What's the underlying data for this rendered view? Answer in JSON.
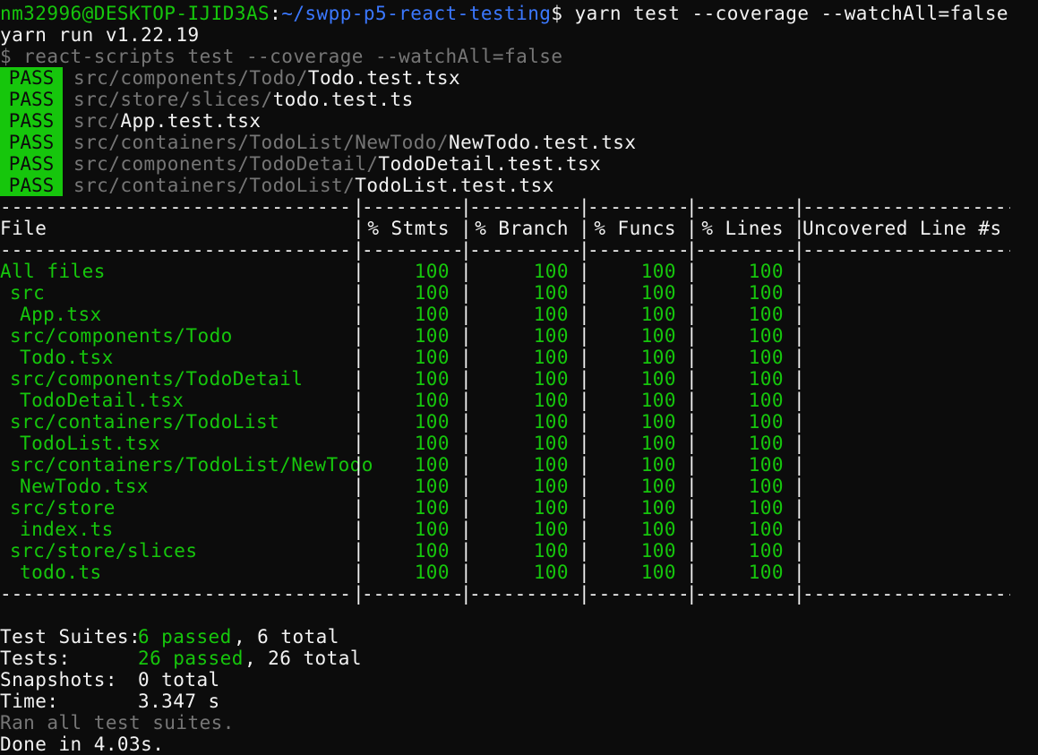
{
  "prompt": {
    "user_host": "nm32996@DESKTOP-IJID3AS",
    "path": "~/swpp-p5-react-testing",
    "symbol": "$",
    "command": "yarn test --coverage --watchAll=false"
  },
  "yarn_line": "yarn run v1.22.19",
  "script_line": "$ react-scripts test --coverage --watchAll=false",
  "test_results": [
    {
      "status": "PASS",
      "dir": "src/components/Todo/",
      "file": "Todo.test.tsx"
    },
    {
      "status": "PASS",
      "dir": "src/store/slices/",
      "file": "todo.test.ts"
    },
    {
      "status": "PASS",
      "dir": "src/",
      "file": "App.test.tsx"
    },
    {
      "status": "PASS",
      "dir": "src/containers/TodoList/NewTodo/",
      "file": "NewTodo.test.tsx"
    },
    {
      "status": "PASS",
      "dir": "src/components/TodoDetail/",
      "file": "TodoDetail.test.tsx"
    },
    {
      "status": "PASS",
      "dir": "src/containers/TodoList/",
      "file": "TodoList.test.tsx"
    }
  ],
  "coverage_table": {
    "headers": [
      "File",
      "% Stmts",
      "% Branch",
      "% Funcs",
      "% Lines",
      "Uncovered Line #s"
    ],
    "rows": [
      {
        "file": "All files",
        "indent": 0,
        "stmts": "100",
        "branch": "100",
        "funcs": "100",
        "lines": "100",
        "uncovered": ""
      },
      {
        "file": "src",
        "indent": 1,
        "stmts": "100",
        "branch": "100",
        "funcs": "100",
        "lines": "100",
        "uncovered": ""
      },
      {
        "file": "App.tsx",
        "indent": 2,
        "stmts": "100",
        "branch": "100",
        "funcs": "100",
        "lines": "100",
        "uncovered": ""
      },
      {
        "file": "src/components/Todo",
        "indent": 1,
        "stmts": "100",
        "branch": "100",
        "funcs": "100",
        "lines": "100",
        "uncovered": ""
      },
      {
        "file": "Todo.tsx",
        "indent": 2,
        "stmts": "100",
        "branch": "100",
        "funcs": "100",
        "lines": "100",
        "uncovered": ""
      },
      {
        "file": "src/components/TodoDetail",
        "indent": 1,
        "stmts": "100",
        "branch": "100",
        "funcs": "100",
        "lines": "100",
        "uncovered": ""
      },
      {
        "file": "TodoDetail.tsx",
        "indent": 2,
        "stmts": "100",
        "branch": "100",
        "funcs": "100",
        "lines": "100",
        "uncovered": ""
      },
      {
        "file": "src/containers/TodoList",
        "indent": 1,
        "stmts": "100",
        "branch": "100",
        "funcs": "100",
        "lines": "100",
        "uncovered": ""
      },
      {
        "file": "TodoList.tsx",
        "indent": 2,
        "stmts": "100",
        "branch": "100",
        "funcs": "100",
        "lines": "100",
        "uncovered": ""
      },
      {
        "file": "src/containers/TodoList/NewTodo",
        "indent": 1,
        "stmts": "100",
        "branch": "100",
        "funcs": "100",
        "lines": "100",
        "uncovered": ""
      },
      {
        "file": "NewTodo.tsx",
        "indent": 2,
        "stmts": "100",
        "branch": "100",
        "funcs": "100",
        "lines": "100",
        "uncovered": ""
      },
      {
        "file": "src/store",
        "indent": 1,
        "stmts": "100",
        "branch": "100",
        "funcs": "100",
        "lines": "100",
        "uncovered": ""
      },
      {
        "file": "index.ts",
        "indent": 2,
        "stmts": "100",
        "branch": "100",
        "funcs": "100",
        "lines": "100",
        "uncovered": ""
      },
      {
        "file": "src/store/slices",
        "indent": 1,
        "stmts": "100",
        "branch": "100",
        "funcs": "100",
        "lines": "100",
        "uncovered": ""
      },
      {
        "file": "todo.ts",
        "indent": 2,
        "stmts": "100",
        "branch": "100",
        "funcs": "100",
        "lines": "100",
        "uncovered": ""
      }
    ]
  },
  "summary": {
    "suites_label": "Test Suites:",
    "suites_passed": "6 passed",
    "suites_total": ", 6 total",
    "tests_label": "Tests:",
    "tests_passed": "26 passed",
    "tests_total": ", 26 total",
    "snapshots_label": "Snapshots:",
    "snapshots_value": "0 total",
    "time_label": "Time:",
    "time_value": "3.347 s",
    "ran_all": "Ran all test suites.",
    "done": "Done in 4.03s."
  },
  "colors": {
    "background": "#0c0c0c",
    "text": "#f2f2f2",
    "green": "#16c60c",
    "blue": "#3b78ff",
    "gray": "#767676"
  }
}
